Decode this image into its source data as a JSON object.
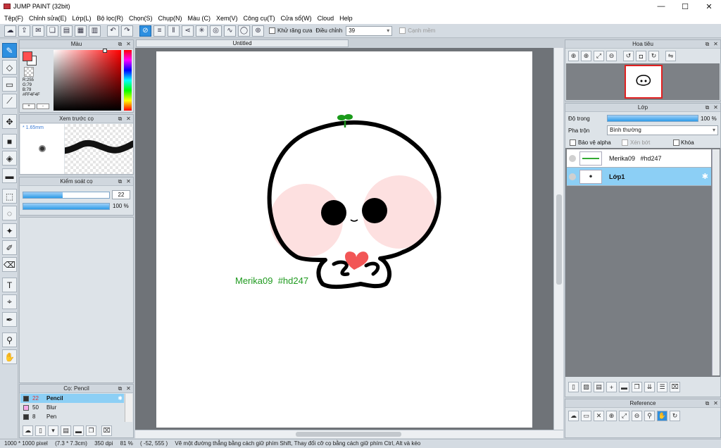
{
  "window": {
    "title": "JUMP PAINT (32bit)",
    "min": "—",
    "max": "☐",
    "close": "✕"
  },
  "menu": [
    "Tệp(F)",
    "Chỉnh sửa(E)",
    "Lớp(L)",
    "Bộ lọc(R)",
    "Chọn(S)",
    "Chụp(N)",
    "Màu (C)",
    "Xem(V)",
    "Công cụ(T)",
    "Cửa sổ(W)",
    "Cloud",
    "Help"
  ],
  "toolbar": {
    "antialias_label": "Khử răng cưa",
    "adjust_label": "Điều chỉnh",
    "adjust_value": "39",
    "snap_label": "Cạnh mềm"
  },
  "color_panel": {
    "title": "Màu",
    "r": "R:255",
    "g": "G:79",
    "b": "B:79",
    "hex": "#FF4F4F",
    "color": "#ff4f4f"
  },
  "preview_panel": {
    "title": "Xem trước cọ",
    "size": "* 1.65mm"
  },
  "brush_control": {
    "title": "Kiểm soát cọ",
    "size_value": "22",
    "opacity_value": "100 %",
    "size_fraction": 0.46,
    "opacity_fraction": 1.0
  },
  "brush_panel": {
    "title": "Cọ: Pencil",
    "items": [
      {
        "size": "22",
        "name": "Pencil",
        "color": "#333333"
      },
      {
        "size": "50",
        "name": "Blur",
        "color": "#f7a8e8"
      },
      {
        "size": "8",
        "name": "Pen",
        "color": "#333333"
      }
    ]
  },
  "document": {
    "tab": "Untitled",
    "signature": "Merika09  #hd247"
  },
  "navigator": {
    "title": "Hoa tiêu"
  },
  "layer_panel": {
    "title": "Lớp",
    "opacity_label": "Độ trong",
    "opacity_value": "100 %",
    "blend_label": "Pha trộn",
    "blend_value": "Bình thường",
    "protect_alpha": "Bảo vệ alpha",
    "clip": "Xén bớt",
    "lock": "Khóa",
    "layers": [
      {
        "name": "Merika09   #hd247"
      },
      {
        "name": "Lớp1"
      }
    ]
  },
  "reference": {
    "title": "Reference"
  },
  "status": {
    "size": "1000 * 1000 pixel",
    "cm": "(7.3 * 7.3cm)",
    "dpi": "350 dpi",
    "zoom": "81 %",
    "coords": "( -52, 555 )",
    "hint": "Vẽ một đường thẳng bằng cách giữ phím Shift, Thay đổi cỡ cọ bằng cách giữ phím Ctrl, Alt và kéo"
  }
}
